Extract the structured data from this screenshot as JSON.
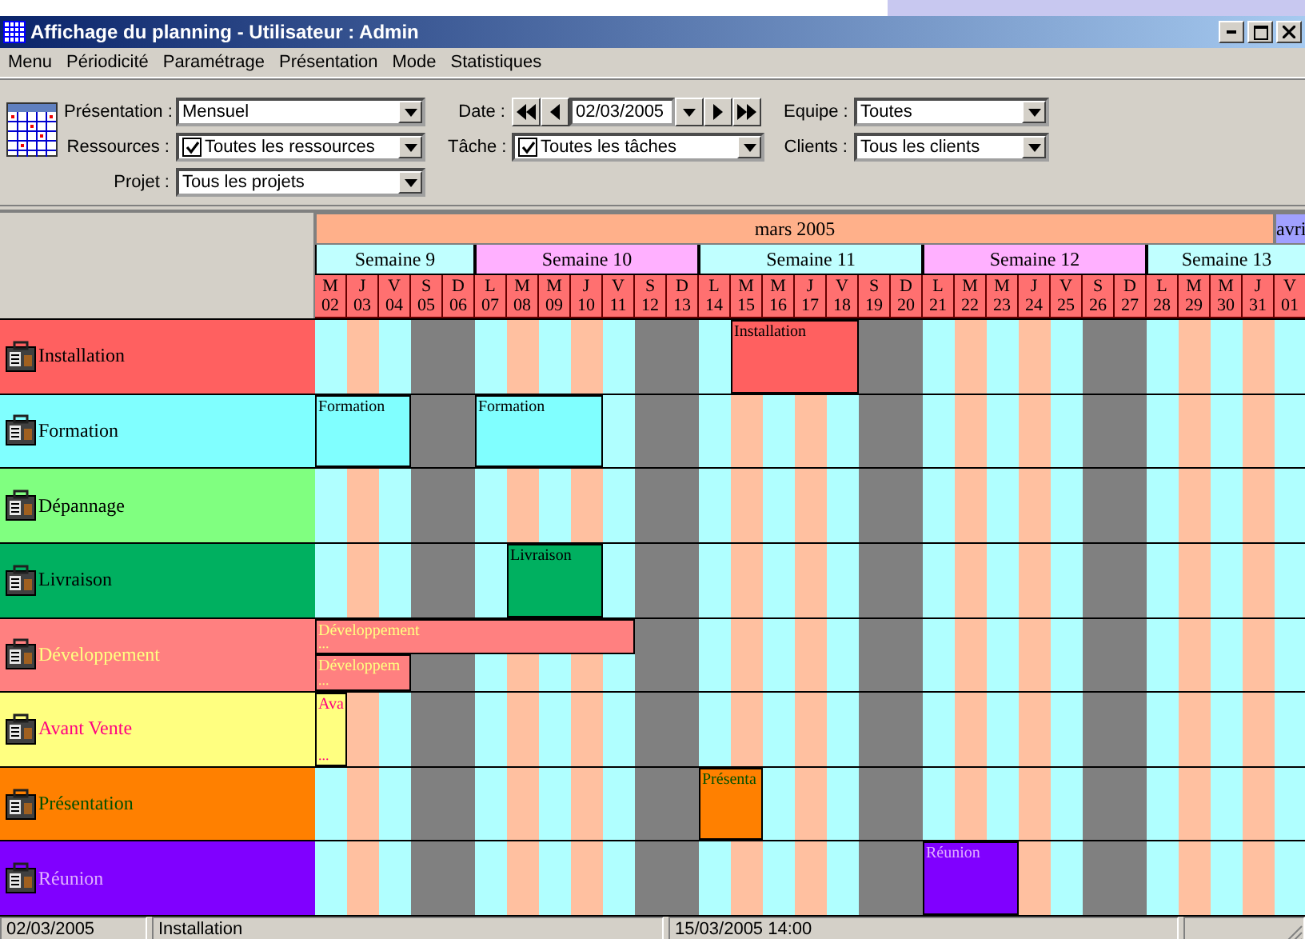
{
  "window": {
    "title": "Affichage du planning - Utilisateur : Admin"
  },
  "menu": [
    "Menu",
    "Périodicité",
    "Paramétrage",
    "Présentation",
    "Mode",
    "Statistiques"
  ],
  "toolbar": {
    "columns": [
      [
        {
          "kind": "combo",
          "label": "Présentation :",
          "value": "Mensuel"
        },
        {
          "kind": "check_combo",
          "label": "Ressources :",
          "value": "Toutes les ressources",
          "checked": true
        },
        {
          "kind": "combo",
          "label": "Projet :",
          "value": "Tous les projets"
        }
      ],
      [
        {
          "kind": "date",
          "label": "Date :",
          "value": "02/03/2005"
        },
        {
          "kind": "check_combo",
          "label": "Tâche :",
          "value": "Toutes les tâches",
          "checked": true
        }
      ],
      [
        {
          "kind": "combo",
          "label": "Equipe :",
          "value": "Toutes"
        },
        {
          "kind": "combo",
          "label": "Clients :",
          "value": "Tous les clients"
        }
      ]
    ]
  },
  "planning": {
    "months": [
      "mars 2005",
      "avri"
    ],
    "weeks": [
      "Semaine 9",
      "Semaine 10",
      "Semaine 11",
      "Semaine 12",
      "Semaine 13"
    ],
    "days": [
      {
        "letter": "M",
        "num": "02",
        "kind": "weekday"
      },
      {
        "letter": "J",
        "num": "03",
        "kind": "weekday"
      },
      {
        "letter": "V",
        "num": "04",
        "kind": "weekday"
      },
      {
        "letter": "S",
        "num": "05",
        "kind": "weekend"
      },
      {
        "letter": "D",
        "num": "06",
        "kind": "weekend"
      },
      {
        "letter": "L",
        "num": "07",
        "kind": "weekday"
      },
      {
        "letter": "M",
        "num": "08",
        "kind": "weekday"
      },
      {
        "letter": "M",
        "num": "09",
        "kind": "weekday"
      },
      {
        "letter": "J",
        "num": "10",
        "kind": "weekday"
      },
      {
        "letter": "V",
        "num": "11",
        "kind": "weekday"
      },
      {
        "letter": "S",
        "num": "12",
        "kind": "weekend"
      },
      {
        "letter": "D",
        "num": "13",
        "kind": "weekend"
      },
      {
        "letter": "L",
        "num": "14",
        "kind": "weekday"
      },
      {
        "letter": "M",
        "num": "15",
        "kind": "weekday"
      },
      {
        "letter": "M",
        "num": "16",
        "kind": "weekday"
      },
      {
        "letter": "J",
        "num": "17",
        "kind": "weekday"
      },
      {
        "letter": "V",
        "num": "18",
        "kind": "weekday"
      },
      {
        "letter": "S",
        "num": "19",
        "kind": "weekend"
      },
      {
        "letter": "D",
        "num": "20",
        "kind": "weekend"
      },
      {
        "letter": "L",
        "num": "21",
        "kind": "weekday"
      },
      {
        "letter": "M",
        "num": "22",
        "kind": "weekday"
      },
      {
        "letter": "M",
        "num": "23",
        "kind": "weekday"
      },
      {
        "letter": "J",
        "num": "24",
        "kind": "weekday"
      },
      {
        "letter": "V",
        "num": "25",
        "kind": "weekday"
      },
      {
        "letter": "S",
        "num": "26",
        "kind": "weekend"
      },
      {
        "letter": "D",
        "num": "27",
        "kind": "weekend"
      },
      {
        "letter": "L",
        "num": "28",
        "kind": "weekday"
      },
      {
        "letter": "M",
        "num": "29",
        "kind": "weekday"
      },
      {
        "letter": "M",
        "num": "30",
        "kind": "weekday"
      },
      {
        "letter": "J",
        "num": "31",
        "kind": "weekday"
      },
      {
        "letter": "V",
        "num": "01",
        "kind": "weekday"
      }
    ],
    "resources": [
      {
        "name": {
          "text": "Installation",
          "color": "#000000"
        },
        "color": "#ff6060",
        "lanes": [
          {
            "tasks": [
              {
                "title": "Installation"
              }
            ],
            "cells": [
              {
                "busy": false
              },
              {
                "busy": false
              },
              {
                "busy": false
              },
              {
                "busy": false
              },
              {
                "busy": false
              },
              {
                "busy": false
              },
              {
                "busy": false
              },
              {
                "busy": false
              },
              {
                "busy": false
              },
              {
                "busy": false
              },
              {
                "busy": false
              },
              {
                "busy": false
              },
              {
                "busy": false
              },
              {
                "busy": true
              },
              {
                "busy": true
              },
              {
                "busy": true
              },
              {
                "busy": true
              },
              {
                "busy": false
              },
              {
                "busy": false
              },
              {
                "busy": false
              },
              {
                "busy": false
              },
              {
                "busy": false
              },
              {
                "busy": false
              },
              {
                "busy": false
              },
              {
                "busy": false
              },
              {
                "busy": false
              },
              {
                "busy": false
              },
              {
                "busy": false
              },
              {
                "busy": false
              },
              {
                "busy": false
              },
              {
                "busy": false
              }
            ]
          }
        ]
      },
      {
        "name": {
          "text": "Formation",
          "color": "#000000"
        },
        "color": "#80ffff",
        "lanes": [
          {
            "tasks": [
              {
                "title": "Formation"
              },
              {
                "title": "Formation"
              }
            ],
            "cells": [
              {
                "busy": true
              },
              {
                "busy": true
              },
              {
                "busy": true
              },
              {
                "busy": false
              },
              {
                "busy": false
              },
              {
                "busy": true
              },
              {
                "busy": true
              },
              {
                "busy": true
              },
              {
                "busy": true
              },
              {
                "busy": false
              },
              {
                "busy": false
              },
              {
                "busy": false
              },
              {
                "busy": false
              },
              {
                "busy": false
              },
              {
                "busy": false
              },
              {
                "busy": false
              },
              {
                "busy": false
              },
              {
                "busy": false
              },
              {
                "busy": false
              },
              {
                "busy": false
              },
              {
                "busy": false
              },
              {
                "busy": false
              },
              {
                "busy": false
              },
              {
                "busy": false
              },
              {
                "busy": false
              },
              {
                "busy": false
              },
              {
                "busy": false
              },
              {
                "busy": false
              },
              {
                "busy": false
              },
              {
                "busy": false
              },
              {
                "busy": false
              }
            ]
          }
        ]
      },
      {
        "name": {
          "text": "Dépannage",
          "color": "#000000"
        },
        "color": "#80ff80"
      },
      {
        "name": {
          "text": "Livraison",
          "color": "#000000"
        },
        "color": "#00b060",
        "lanes": [
          {
            "tasks": [
              {
                "title": "Livraison"
              }
            ],
            "cells": [
              {
                "busy": false
              },
              {
                "busy": false
              },
              {
                "busy": false
              },
              {
                "busy": false
              },
              {
                "busy": false
              },
              {
                "busy": false
              },
              {
                "busy": true
              },
              {
                "busy": true
              },
              {
                "busy": true
              },
              {
                "busy": false
              },
              {
                "busy": false
              },
              {
                "busy": false
              },
              {
                "busy": false
              },
              {
                "busy": false
              },
              {
                "busy": false
              },
              {
                "busy": false
              },
              {
                "busy": false
              },
              {
                "busy": false
              },
              {
                "busy": false
              },
              {
                "busy": false
              },
              {
                "busy": false
              },
              {
                "busy": false
              },
              {
                "busy": false
              },
              {
                "busy": false
              },
              {
                "busy": false
              },
              {
                "busy": false
              },
              {
                "busy": false
              },
              {
                "busy": false
              },
              {
                "busy": false
              },
              {
                "busy": false
              },
              {
                "busy": false
              }
            ]
          }
        ]
      },
      {
        "name": {
          "text": "Développement",
          "color": "#ffff80"
        },
        "color": "#ff8080",
        "lanes": [
          {
            "tasks": [
              {
                "title": "Développement",
                "more": "..."
              }
            ],
            "cells": [
              {
                "busy": true
              },
              {
                "busy": true
              },
              {
                "busy": true
              },
              {
                "busy": true
              },
              {
                "busy": true
              },
              {
                "busy": true
              },
              {
                "busy": true
              },
              {
                "busy": true
              },
              {
                "busy": true
              },
              {
                "busy": true
              },
              {
                "busy": false
              },
              {
                "busy": false
              },
              {
                "busy": false
              },
              {
                "busy": false
              },
              {
                "busy": false
              },
              {
                "busy": false
              },
              {
                "busy": false
              },
              {
                "busy": false
              },
              {
                "busy": false
              },
              {
                "busy": false
              },
              {
                "busy": false
              },
              {
                "busy": false
              },
              {
                "busy": false
              },
              {
                "busy": false
              },
              {
                "busy": false
              },
              {
                "busy": false
              },
              {
                "busy": false
              },
              {
                "busy": false
              },
              {
                "busy": false
              },
              {
                "busy": false
              },
              {
                "busy": false
              }
            ]
          },
          {
            "tasks": [
              {
                "title": "Développem",
                "more": "..."
              }
            ],
            "cells": [
              {
                "busy": true
              },
              {
                "busy": true
              },
              {
                "busy": true
              },
              {
                "busy": false
              },
              {
                "busy": false
              },
              {
                "busy": false
              },
              {
                "busy": false
              },
              {
                "busy": false
              },
              {
                "busy": false
              },
              {
                "busy": false
              },
              {
                "busy": false
              },
              {
                "busy": false
              },
              {
                "busy": false
              },
              {
                "busy": false
              },
              {
                "busy": false
              },
              {
                "busy": false
              },
              {
                "busy": false
              },
              {
                "busy": false
              },
              {
                "busy": false
              },
              {
                "busy": false
              },
              {
                "busy": false
              },
              {
                "busy": false
              },
              {
                "busy": false
              },
              {
                "busy": false
              },
              {
                "busy": false
              },
              {
                "busy": false
              },
              {
                "busy": false
              },
              {
                "busy": false
              },
              {
                "busy": false
              },
              {
                "busy": false
              },
              {
                "busy": false
              }
            ]
          }
        ]
      },
      {
        "name": {
          "text": "Avant Vente",
          "color": "#ff0080"
        },
        "color": "#ffff80",
        "lanes": [
          {
            "tasks": [
              {
                "title": "Ava",
                "more": "..."
              }
            ],
            "cells": [
              {
                "busy": true
              },
              {
                "busy": false
              },
              {
                "busy": false
              },
              {
                "busy": false
              },
              {
                "busy": false
              },
              {
                "busy": false
              },
              {
                "busy": false
              },
              {
                "busy": false
              },
              {
                "busy": false
              },
              {
                "busy": false
              },
              {
                "busy": false
              },
              {
                "busy": false
              },
              {
                "busy": false
              },
              {
                "busy": false
              },
              {
                "busy": false
              },
              {
                "busy": false
              },
              {
                "busy": false
              },
              {
                "busy": false
              },
              {
                "busy": false
              },
              {
                "busy": false
              },
              {
                "busy": false
              },
              {
                "busy": false
              },
              {
                "busy": false
              },
              {
                "busy": false
              },
              {
                "busy": false
              },
              {
                "busy": false
              },
              {
                "busy": false
              },
              {
                "busy": false
              },
              {
                "busy": false
              },
              {
                "busy": false
              },
              {
                "busy": false
              }
            ]
          }
        ]
      },
      {
        "name": {
          "text": "Présentation",
          "color": "#005000"
        },
        "color": "#ff8000",
        "lanes": [
          {
            "tasks": [
              {
                "title": "Présenta"
              }
            ],
            "cells": [
              {
                "busy": false
              },
              {
                "busy": false
              },
              {
                "busy": false
              },
              {
                "busy": false
              },
              {
                "busy": false
              },
              {
                "busy": false
              },
              {
                "busy": false
              },
              {
                "busy": false
              },
              {
                "busy": false
              },
              {
                "busy": false
              },
              {
                "busy": false
              },
              {
                "busy": false
              },
              {
                "busy": true
              },
              {
                "busy": true
              },
              {
                "busy": false
              },
              {
                "busy": false
              },
              {
                "busy": false
              },
              {
                "busy": false
              },
              {
                "busy": false
              },
              {
                "busy": false
              },
              {
                "busy": false
              },
              {
                "busy": false
              },
              {
                "busy": false
              },
              {
                "busy": false
              },
              {
                "busy": false
              },
              {
                "busy": false
              },
              {
                "busy": false
              },
              {
                "busy": false
              },
              {
                "busy": false
              },
              {
                "busy": false
              },
              {
                "busy": false
              }
            ]
          }
        ]
      },
      {
        "name": {
          "text": "Réunion",
          "color": "#e0b0ff"
        },
        "color": "#8000ff",
        "lanes": [
          {
            "tasks": [
              {
                "title": "Réunion"
              }
            ],
            "cells": [
              {
                "busy": false
              },
              {
                "busy": false
              },
              {
                "busy": false
              },
              {
                "busy": false
              },
              {
                "busy": false
              },
              {
                "busy": false
              },
              {
                "busy": false
              },
              {
                "busy": false
              },
              {
                "busy": false
              },
              {
                "busy": false
              },
              {
                "busy": false
              },
              {
                "busy": false
              },
              {
                "busy": false
              },
              {
                "busy": false
              },
              {
                "busy": false
              },
              {
                "busy": false
              },
              {
                "busy": false
              },
              {
                "busy": false
              },
              {
                "busy": false
              },
              {
                "busy": true
              },
              {
                "busy": true
              },
              {
                "busy": true
              },
              {
                "busy": false
              },
              {
                "busy": false
              },
              {
                "busy": false
              },
              {
                "busy": false
              },
              {
                "busy": false
              },
              {
                "busy": false
              },
              {
                "busy": false
              },
              {
                "busy": false
              },
              {
                "busy": false
              }
            ]
          }
        ]
      }
    ]
  },
  "status_bar": [
    "02/03/2005",
    "Installation",
    "15/03/2005 14:00"
  ]
}
